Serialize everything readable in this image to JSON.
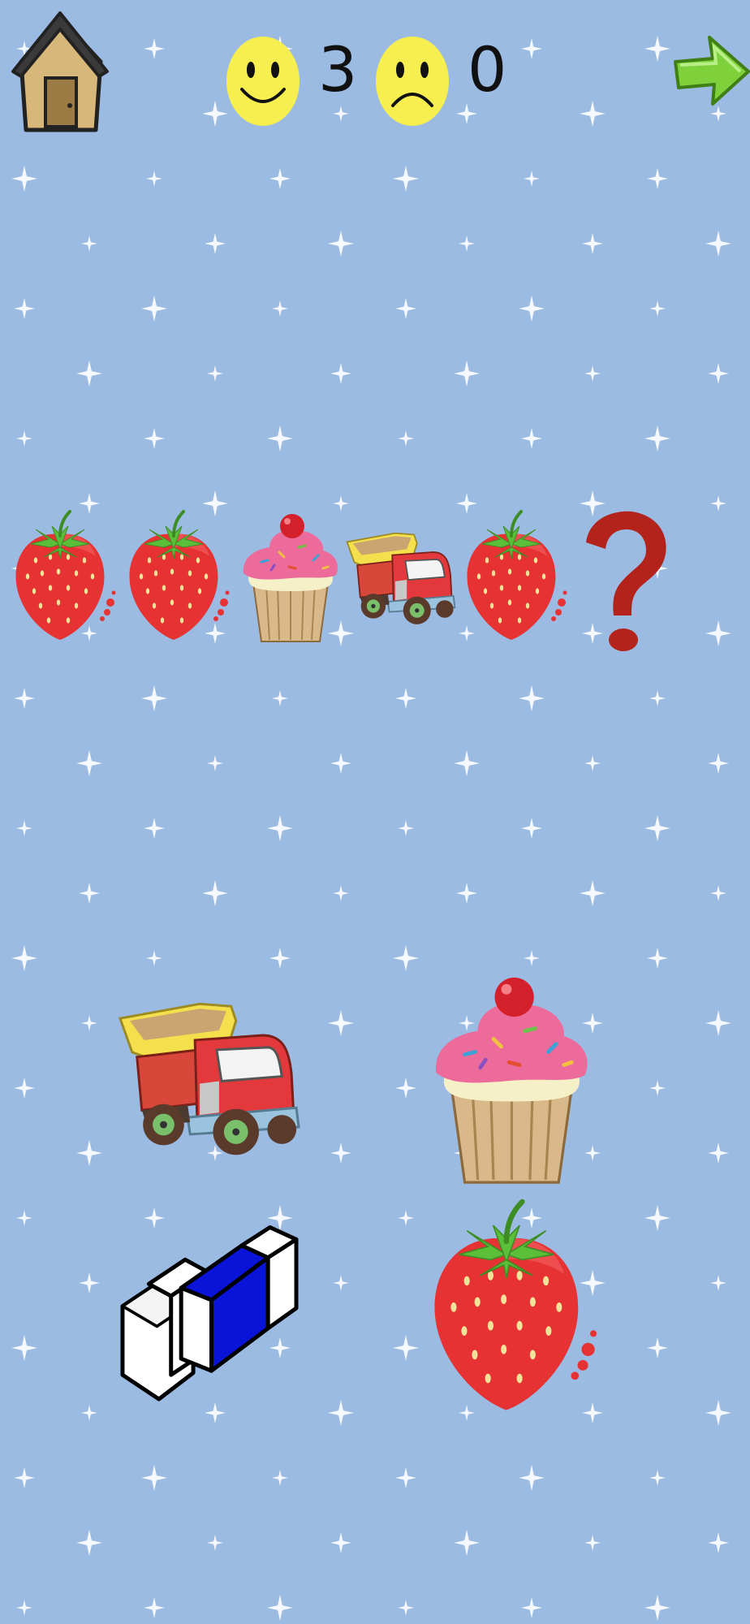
{
  "header": {
    "home_icon": "house-icon",
    "next_icon": "green-right-arrow-icon",
    "correct_icon": "smiley-happy-icon",
    "wrong_icon": "smiley-sad-icon",
    "correct_count": "3",
    "wrong_count": "0"
  },
  "sequence": {
    "items": [
      "strawberry",
      "strawberry",
      "cupcake",
      "dump-truck",
      "strawberry"
    ],
    "unknown_symbol": "?"
  },
  "choices": [
    "dump-truck",
    "cupcake",
    "eraser",
    "strawberry"
  ],
  "colors": {
    "background": "#9bbbe2",
    "strawberry": "#e63232",
    "question_mark": "#b3221b",
    "arrow": "#7fd13b",
    "smiley": "#f7ef4f",
    "eraser_band": "#0a14d8"
  }
}
